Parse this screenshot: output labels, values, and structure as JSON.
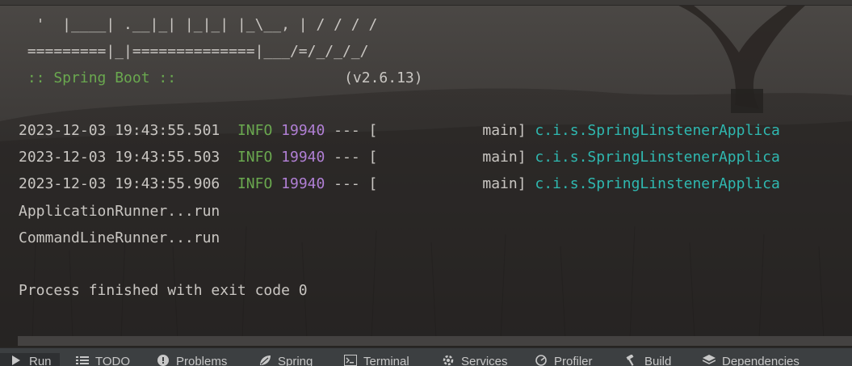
{
  "console": {
    "banner": [
      "  '  |____| .__|_| |_|_| |_\\__, | / / / /",
      " =========|_|==============|___/=/_/_/_/"
    ],
    "boot_label": " :: Spring Boot ::",
    "boot_version": "(v2.6.13)",
    "log_rows": [
      {
        "timestamp": "2023-12-03 19:43:55.501",
        "level": "INFO",
        "pid": "19940",
        "sep": "--- [",
        "thread": "main]",
        "logger": "c.i.s.SpringLinstenerApplica"
      },
      {
        "timestamp": "2023-12-03 19:43:55.503",
        "level": "INFO",
        "pid": "19940",
        "sep": "--- [",
        "thread": "main]",
        "logger": "c.i.s.SpringLinstenerApplica"
      },
      {
        "timestamp": "2023-12-03 19:43:55.906",
        "level": "INFO",
        "pid": "19940",
        "sep": "--- [",
        "thread": "main]",
        "logger": "c.i.s.SpringLinstenerApplica"
      }
    ],
    "output_lines": [
      "ApplicationRunner...run",
      "CommandLineRunner...run"
    ],
    "exit_message": "Process finished with exit code 0"
  },
  "colors": {
    "green": "#6aa84f",
    "purple": "#b07fd4",
    "cyan": "#2fb8b0",
    "text": "#c9c6c2"
  },
  "toolwindows": [
    {
      "label": "Run",
      "icon": "play-icon"
    },
    {
      "label": "TODO",
      "icon": "list-icon"
    },
    {
      "label": "Problems",
      "icon": "warning-icon"
    },
    {
      "label": "Spring",
      "icon": "spring-leaf-icon"
    },
    {
      "label": "Terminal",
      "icon": "terminal-icon"
    },
    {
      "label": "Services",
      "icon": "services-icon"
    },
    {
      "label": "Profiler",
      "icon": "profiler-icon"
    },
    {
      "label": "Build",
      "icon": "hammer-icon"
    },
    {
      "label": "Dependencies",
      "icon": "dependencies-icon"
    }
  ]
}
